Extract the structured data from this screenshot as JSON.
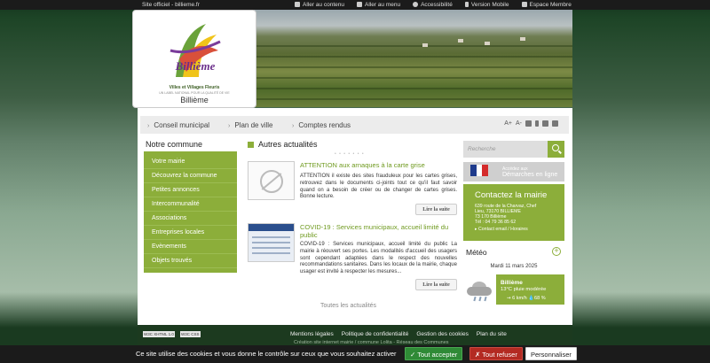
{
  "topbar": {
    "site": "Site officiel - billieme.fr",
    "links": [
      {
        "label": "Aller au contenu",
        "icon": "monitor-icon"
      },
      {
        "label": "Aller au menu",
        "icon": "monitor-icon"
      },
      {
        "label": "Accessibilité",
        "icon": "eye-icon"
      },
      {
        "label": "Version Mobile",
        "icon": "mobile-icon"
      },
      {
        "label": "Espace Membre",
        "icon": "member-icon"
      }
    ]
  },
  "logo": {
    "brand_word": "Billième",
    "label_villes": "Villes et Villages Fleuris",
    "label_tiny": "UN LABEL NATIONAL POUR LA QUALITÉ DE VIE",
    "commune_name": "Billième"
  },
  "nav": {
    "items": [
      "Conseil municipal",
      "Plan de ville",
      "Comptes rendus"
    ],
    "tools": {
      "font_up": "A+",
      "font_down": "A-"
    }
  },
  "sidebar": {
    "title": "Notre commune",
    "items": [
      "Votre mairie",
      "Découvrez la commune",
      "Petites annonces",
      "Intercommunalité",
      "Associations",
      "Entreprises locales",
      "Evènements",
      "Objets trouvés"
    ]
  },
  "news": {
    "title": "Autres actualités",
    "dots": "• • • • • • •",
    "articles": [
      {
        "title": "ATTENTION aux arnaques à la carte grise",
        "text": "ATTENTION il existe des sites frauduleux pour les cartes grises, retrouvez dans le documents ci-joints tout ce qu'il faut savoir quand on a besoin de créer ou de changer de cartes grises. Bonne lecture.",
        "more": "Lire la suite"
      },
      {
        "title": "COVID-19 : Services municipaux, accueil limité du public",
        "text": "COVID-19 : Services municipaux, accueil limité du public La mairie à réouvert ses portes. Les modalités d'accueil des usagers sont cependant adaptées dans le respect des nouvelles recommandations sanitaires. Dans les locaux de la mairie, chaque usager est invité à respecter les mesures...",
        "more": "Lire la suite"
      }
    ],
    "all_label": "Toutes les actualités"
  },
  "search": {
    "placeholder": "Recherche"
  },
  "demarches": {
    "line1": "Accédez aux",
    "line2": "Démarches en ligne"
  },
  "contact": {
    "title": "Contactez la mairie",
    "lines": [
      "639 route de la Charvaz, Chef",
      "Lieu, 73170 BILLIEME",
      "73 170 Billième",
      "Tél : 04 79 36 85 62"
    ],
    "link": "Contact email / Horaires"
  },
  "meteo": {
    "title": "Météo",
    "date": "Mardi 11 mars 2025",
    "city": "Billième",
    "desc": "13°C  pluie modérée",
    "wind": "6 km/h",
    "humidity": "68 %"
  },
  "footer": {
    "links": [
      "Mentions légales",
      "Politique de confidentialité",
      "Gestion des cookies",
      "Plan du site"
    ],
    "sub": "Création site internet mairie / commune Lolita - Réseau des Communes",
    "badge1": "W3C XHTML 1.0",
    "badge2": "W3C CSS"
  },
  "cookie": {
    "message": "Ce site utilise des cookies et vous donne le contrôle sur ceux que vous souhaitez activer",
    "accept": "✓ Tout accepter",
    "refuse": "✗ Tout refuser",
    "custom": "Personnaliser"
  },
  "colors": {
    "accent": "#8cae3a",
    "dark": "#1b1b1b",
    "title_green": "#6f9a1f"
  }
}
